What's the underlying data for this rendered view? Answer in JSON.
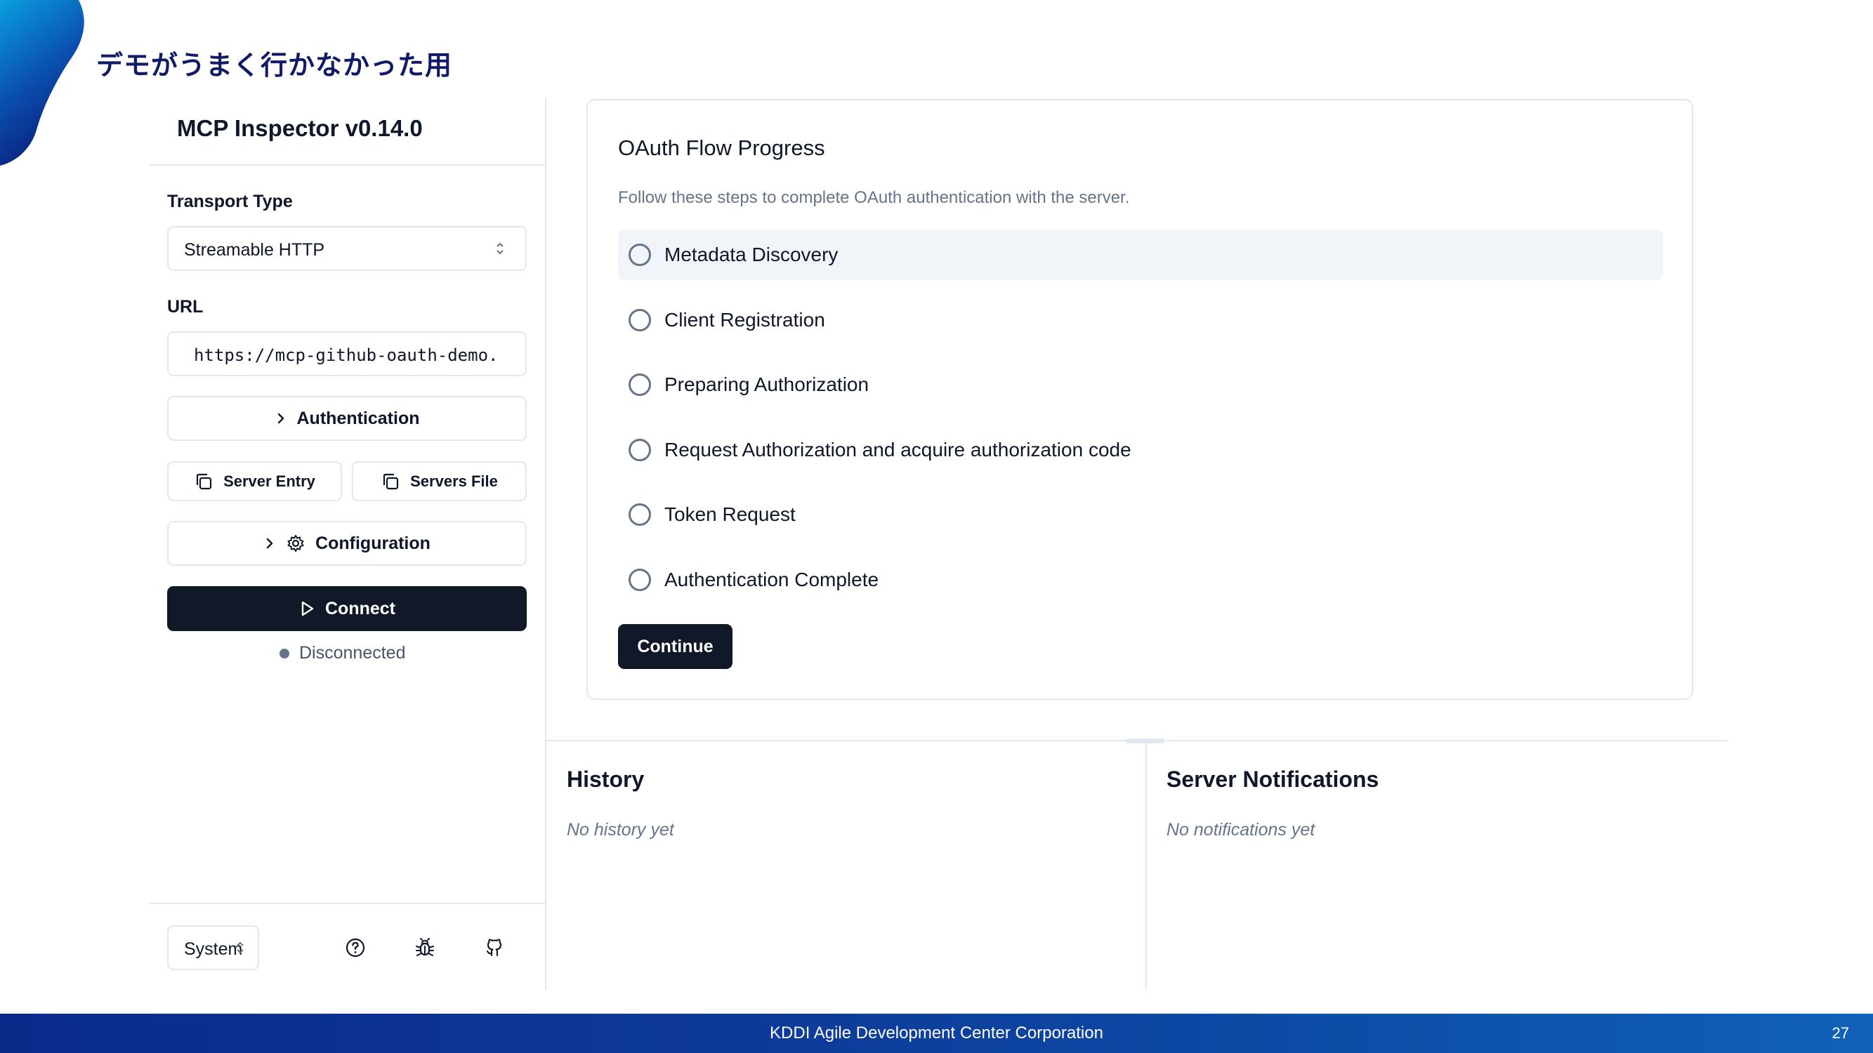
{
  "slide": {
    "title": "デモがうまく行かなかった用",
    "footer_company": "KDDI Agile Development Center Corporation",
    "page_number": "27",
    "brand_colors": {
      "blob_light": "#0a9fe0",
      "blob_dark": "#0a1f7a",
      "footer": "#0d3a99",
      "title": "#111a66"
    }
  },
  "sidebar": {
    "app_title": "MCP Inspector v0.14.0",
    "transport_label": "Transport Type",
    "transport_value": "Streamable HTTP",
    "url_label": "URL",
    "url_value": "https://mcp-github-oauth-demo.",
    "authentication_label": "Authentication",
    "server_entry_label": "Server Entry",
    "servers_file_label": "Servers File",
    "configuration_label": "Configuration",
    "connect_label": "Connect",
    "status_text": "Disconnected",
    "theme_value": "System",
    "icons": [
      "chevron-right-icon",
      "copy-icon",
      "gear-icon",
      "play-icon",
      "help-circle-icon",
      "bug-icon",
      "github-icon"
    ]
  },
  "oauth": {
    "title": "OAuth Flow Progress",
    "description": "Follow these steps to complete OAuth authentication with the server.",
    "steps": [
      {
        "label": "Metadata Discovery",
        "active": true
      },
      {
        "label": "Client Registration",
        "active": false
      },
      {
        "label": "Preparing Authorization",
        "active": false
      },
      {
        "label": "Request Authorization and acquire authorization code",
        "active": false
      },
      {
        "label": "Token Request",
        "active": false
      },
      {
        "label": "Authentication Complete",
        "active": false
      }
    ],
    "continue_label": "Continue"
  },
  "history": {
    "title": "History",
    "empty_text": "No history yet"
  },
  "notifications": {
    "title": "Server Notifications",
    "empty_text": "No notifications yet"
  }
}
